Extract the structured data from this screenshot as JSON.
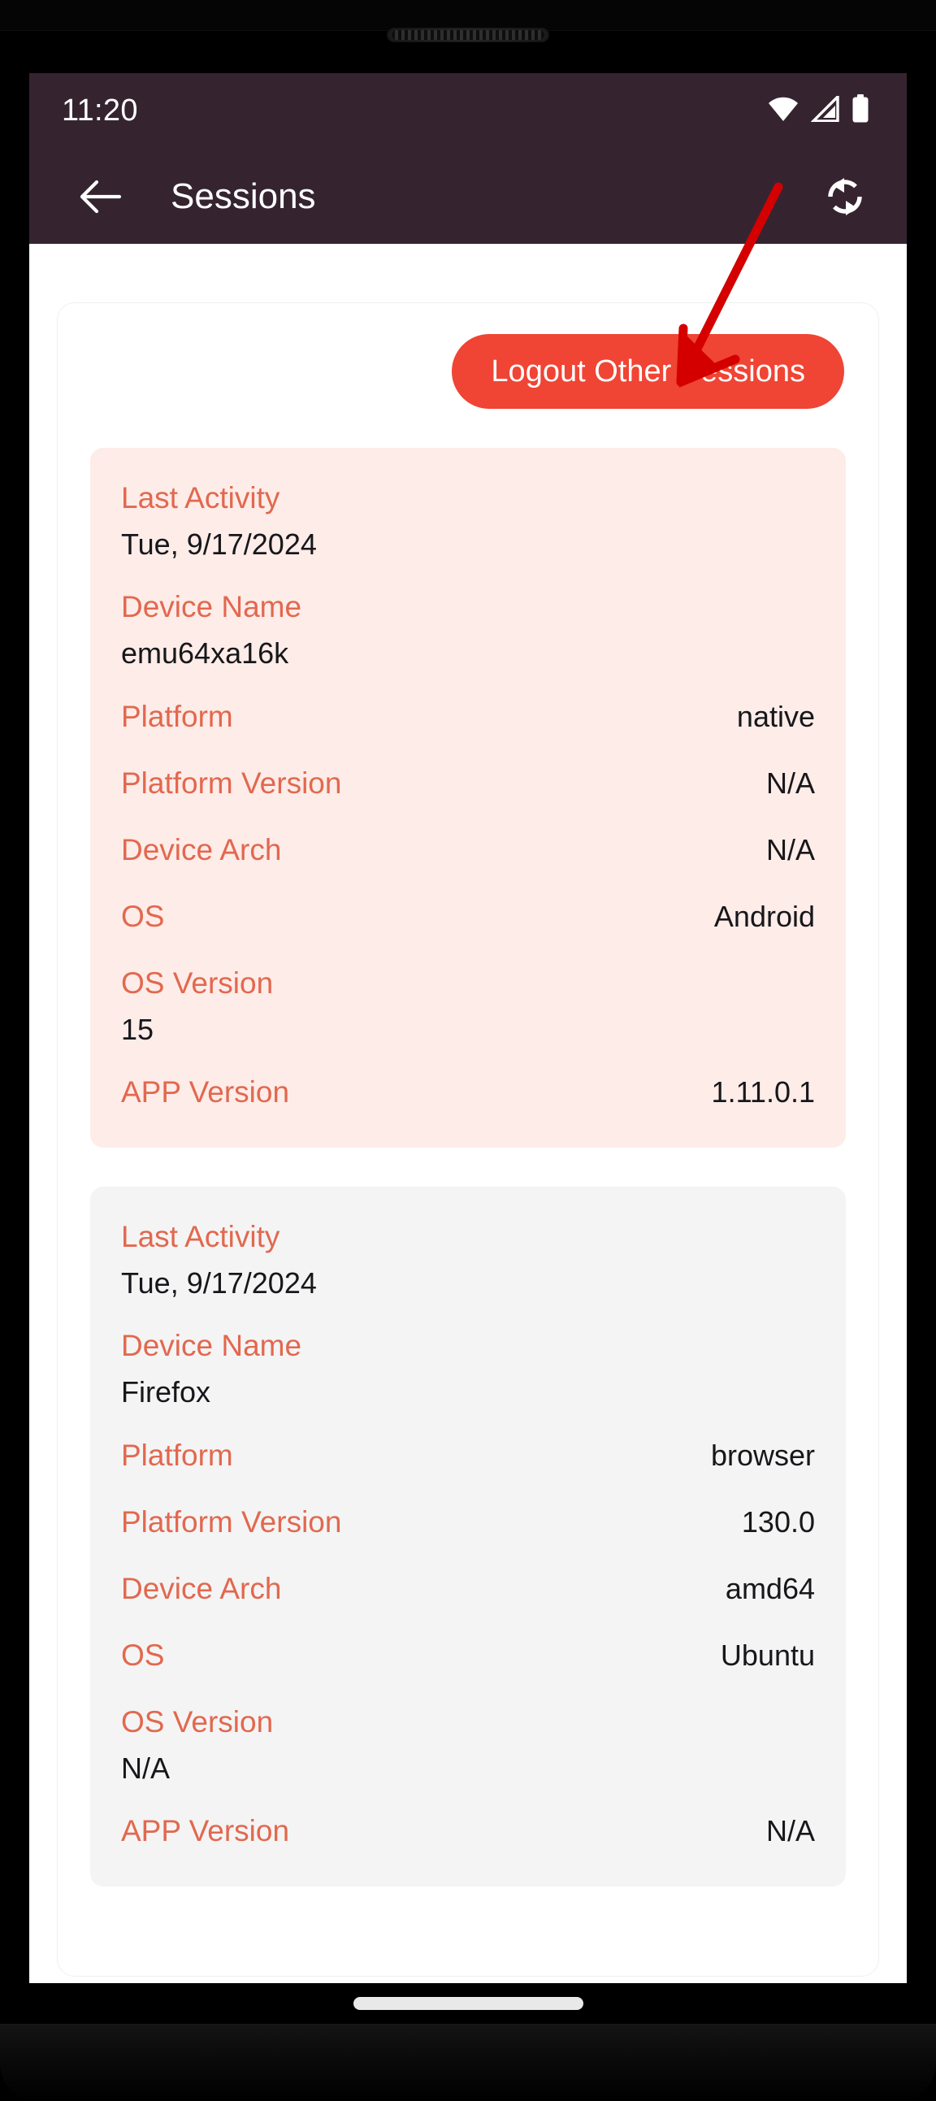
{
  "status_bar": {
    "time": "11:20",
    "icons": [
      "wifi-icon",
      "cellular-signal-icon",
      "battery-icon"
    ]
  },
  "app_bar": {
    "back_icon": "arrow-left-icon",
    "title": "Sessions",
    "refresh_icon": "refresh-sync-icon"
  },
  "actions": {
    "logout_other_sessions": "Logout Other Sessions"
  },
  "annotation": {
    "type": "arrow",
    "color": "#D40000",
    "points_to": "logout-other-sessions-button"
  },
  "colors": {
    "app_bar_bg": "#352430",
    "accent_label": "#E2684F",
    "danger_button": "#F04434",
    "card_highlight_bg": "#FDECE8",
    "card_plain_bg": "#F4F4F4",
    "annotation_red": "#D40000"
  },
  "field_labels": {
    "last_activity": "Last Activity",
    "device_name": "Device Name",
    "platform": "Platform",
    "platform_version": "Platform Version",
    "device_arch": "Device Arch",
    "os": "OS",
    "os_version": "OS Version",
    "app_version": "APP Version"
  },
  "sessions": [
    {
      "current": true,
      "last_activity": "Tue, 9/17/2024",
      "device_name": "emu64xa16k",
      "platform": "native",
      "platform_version": "N/A",
      "device_arch": "N/A",
      "os": "Android",
      "os_version": "15",
      "app_version": "1.11.0.1"
    },
    {
      "current": false,
      "last_activity": "Tue, 9/17/2024",
      "device_name": "Firefox",
      "platform": "browser",
      "platform_version": "130.0",
      "device_arch": "amd64",
      "os": "Ubuntu",
      "os_version": "N/A",
      "app_version": "N/A"
    }
  ],
  "nav_bar": {
    "home_pill": "home-indicator"
  }
}
